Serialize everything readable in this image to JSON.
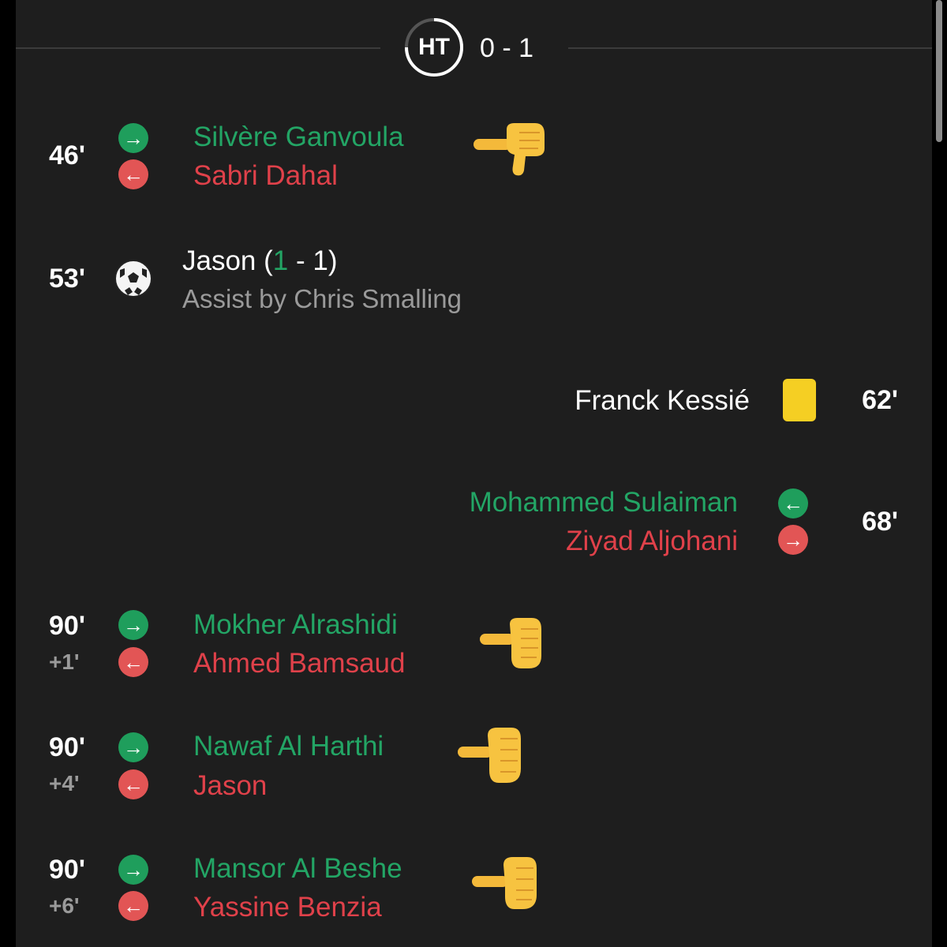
{
  "halftime": {
    "label": "HT",
    "score": "0 - 1"
  },
  "events": {
    "sub46": {
      "minute": "46'",
      "in_player": "Silvère Ganvoula",
      "out_player": "Sabri Dahal",
      "in_icon": "arrow-right-icon",
      "out_icon": "arrow-left-icon",
      "reaction": "thumbs-down-emoji"
    },
    "goal53": {
      "minute": "53'",
      "scorer": "Jason",
      "score_open": " (",
      "score_home": "1",
      "score_rest": " - 1)",
      "assist": "Assist by Chris Smalling",
      "icon": "soccer-ball-icon"
    },
    "card62": {
      "minute": "62'",
      "player": "Franck Kessié",
      "icon": "yellow-card-icon"
    },
    "sub68": {
      "minute": "68'",
      "in_player": "Mohammed Sulaiman",
      "out_player": "Ziyad Aljohani",
      "in_icon": "arrow-left-icon",
      "out_icon": "arrow-right-icon"
    },
    "sub90a": {
      "minute": "90'",
      "stoppage": "+1'",
      "in_player": "Mokher Alrashidi",
      "out_player": "Ahmed Bamsaud",
      "reaction": "thumbs-down-emoji"
    },
    "sub90b": {
      "minute": "90'",
      "stoppage": "+4'",
      "in_player": "Nawaf Al Harthi",
      "out_player": "Jason",
      "reaction": "thumbs-down-emoji"
    },
    "sub90c": {
      "minute": "90'",
      "stoppage": "+6'",
      "in_player": "Mansor Al Beshe",
      "out_player": "Yassine Benzia",
      "reaction": "thumbs-down-emoji"
    }
  },
  "colors": {
    "background": "#1e1e1e",
    "sub_in": "#23a565",
    "sub_out": "#e0414a",
    "yellow_card": "#f5cf23",
    "text": "#ffffff",
    "muted": "#9a9a9a"
  }
}
